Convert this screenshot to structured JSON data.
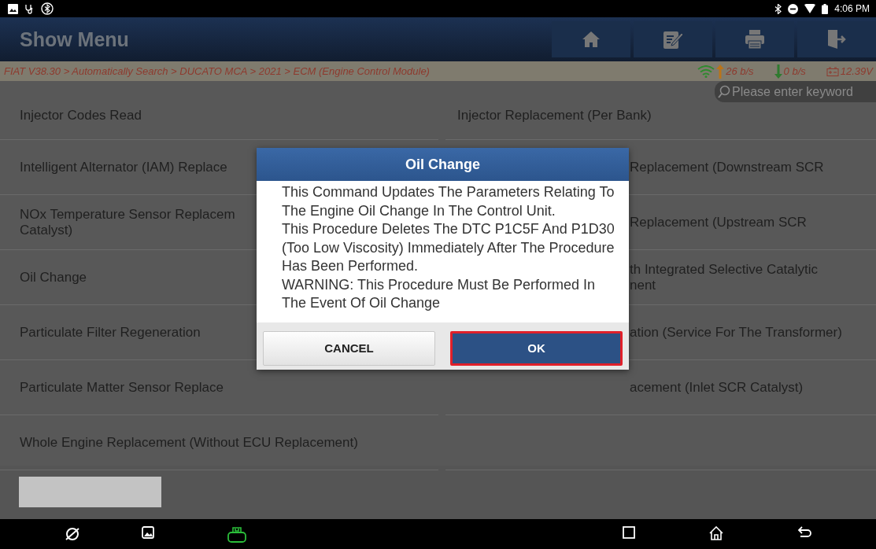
{
  "status_bar": {
    "time": "4:06 PM"
  },
  "header": {
    "title": "Show Menu"
  },
  "breadcrumb": {
    "path": "FIAT V38.30 > Automatically Search > DUCATO MCA > 2021 > ECM (Engine Control Module)",
    "upload": "26 b/s",
    "download": "0 b/s",
    "voltage": "12.39V"
  },
  "search": {
    "placeholder": "Please enter keyword"
  },
  "menu": {
    "rows": [
      {
        "left": "Injector Codes Read",
        "right": "Injector Replacement (Per Bank)"
      },
      {
        "left": "Intelligent Alternator (IAM) Replace",
        "right": "Replacement (Downstream SCR"
      },
      {
        "left": "NOx Temperature Sensor Replacem\nCatalyst)",
        "right": "Replacement (Upstream SCR"
      },
      {
        "left": "Oil Change",
        "right": "th Integrated Selective Catalytic\nnent"
      },
      {
        "left": "Particulate Filter Regeneration",
        "right": "ation (Service For The Transformer)"
      },
      {
        "left": "Particulate Matter Sensor Replace",
        "right": "acement (Inlet SCR Catalyst)"
      },
      {
        "left": "Whole Engine Replacement (Without ECU Replacement)",
        "right": ""
      }
    ]
  },
  "dialog": {
    "title": "Oil Change",
    "paragraphs": [
      "This Command Updates The Parameters Relating To The Engine Oil Change In The Control Unit.",
      "This Procedure Deletes The DTC P1C5F And P1D30 (Too Low Viscosity) Immediately After The Procedure Has Been Performed.",
      "WARNING: This Procedure Must Be Performed In The Event Of Oil Change"
    ],
    "buttons": [
      {
        "label": "CANCEL",
        "kind": "secondary",
        "highlighted": false
      },
      {
        "label": "OK",
        "kind": "primary",
        "highlighted": true
      }
    ]
  }
}
